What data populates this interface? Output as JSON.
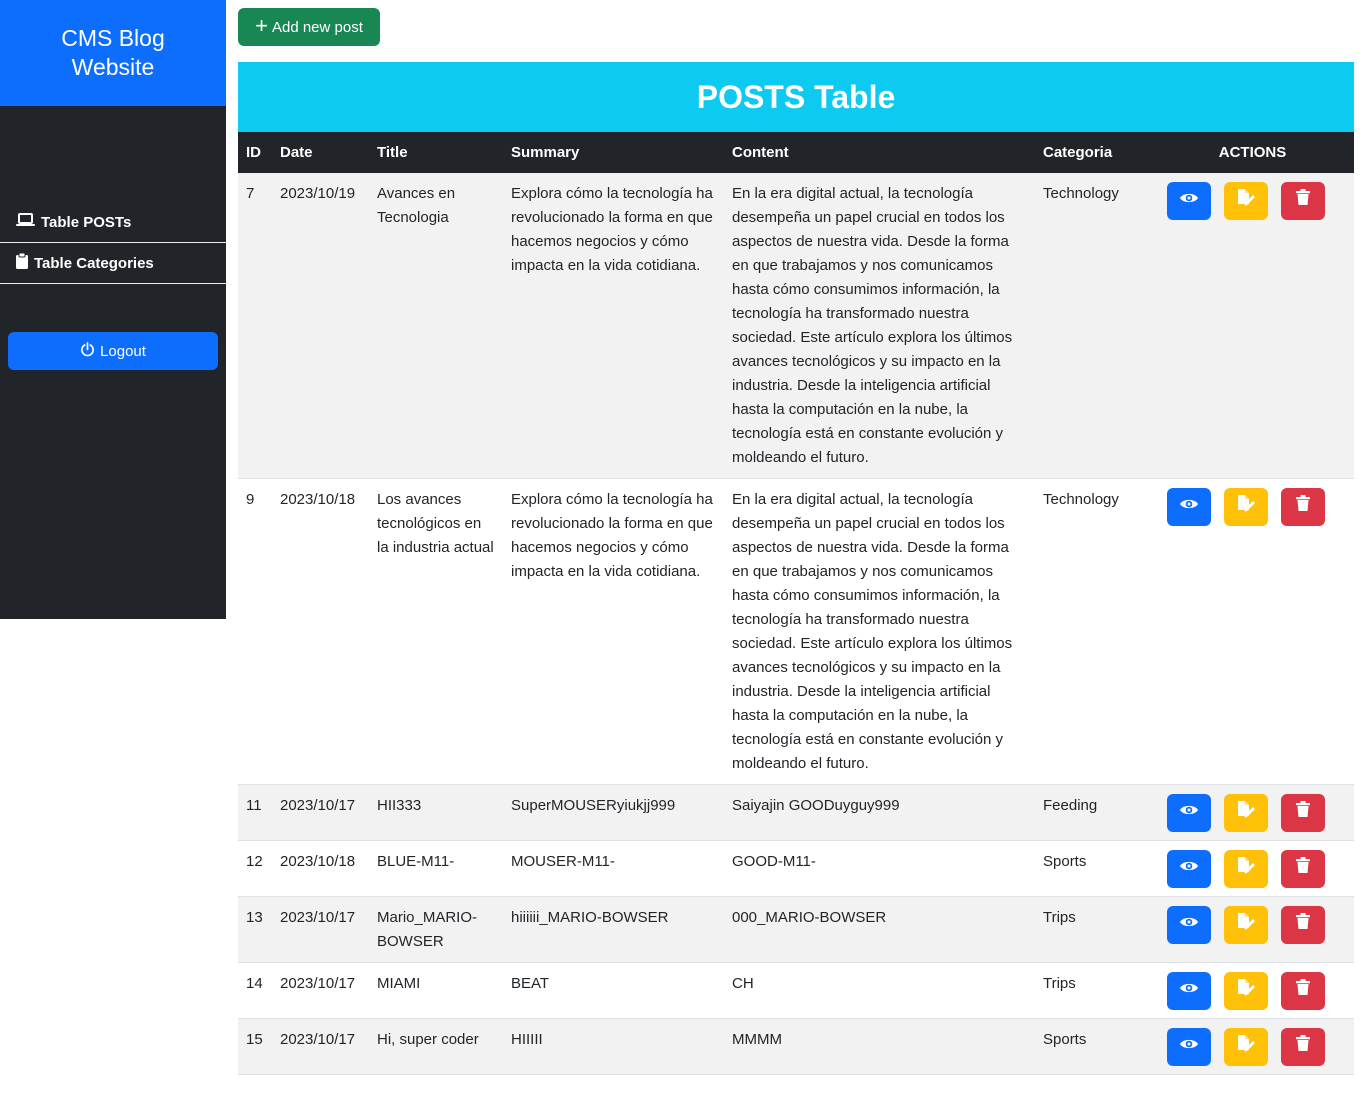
{
  "sidebar": {
    "brand": "CMS Blog Website",
    "items": [
      {
        "label": "Table POSTs",
        "icon": "laptop-icon"
      },
      {
        "label": "Table Categories",
        "icon": "clipboard-icon"
      }
    ],
    "logout_label": "Logout"
  },
  "toolbar": {
    "add_label": "Add new post"
  },
  "table": {
    "title": "POSTS Table",
    "columns": [
      "ID",
      "Date",
      "Title",
      "Summary",
      "Content",
      "Categoria",
      "ACTIONS"
    ],
    "rows": [
      {
        "id": "7",
        "date": "2023/10/19",
        "title": "Avances en Tecnologia",
        "summary": "Explora cómo la tecnología ha revolucionado la forma en que hacemos negocios y cómo impacta en la vida cotidiana.",
        "content": "En la era digital actual, la tecnología desempeña un papel crucial en todos los aspectos de nuestra vida. Desde la forma en que trabajamos y nos comunicamos hasta cómo consumimos información, la tecnología ha transformado nuestra sociedad. Este artículo explora los últimos avances tecnológicos y su impacto en la industria. Desde la inteligencia artificial hasta la computación en la nube, la tecnología está en constante evolución y moldeando el futuro.",
        "category": "Technology"
      },
      {
        "id": "9",
        "date": "2023/10/18",
        "title": "Los avances tecnológicos en la industria actual",
        "summary": "Explora cómo la tecnología ha revolucionado la forma en que hacemos negocios y cómo impacta en la vida cotidiana.",
        "content": "En la era digital actual, la tecnología desempeña un papel crucial en todos los aspectos de nuestra vida. Desde la forma en que trabajamos y nos comunicamos hasta cómo consumimos información, la tecnología ha transformado nuestra sociedad. Este artículo explora los últimos avances tecnológicos y su impacto en la industria. Desde la inteligencia artificial hasta la computación en la nube, la tecnología está en constante evolución y moldeando el futuro.",
        "category": "Technology"
      },
      {
        "id": "11",
        "date": "2023/10/17",
        "title": "HII333",
        "summary": "SuperMOUSERyiukjj999",
        "content": "Saiyajin GOODuyguy999",
        "category": "Feeding"
      },
      {
        "id": "12",
        "date": "2023/10/18",
        "title": "BLUE-M11-",
        "summary": "MOUSER-M11-",
        "content": "GOOD-M11-",
        "category": "Sports"
      },
      {
        "id": "13",
        "date": "2023/10/17",
        "title": "Mario_MARIO-BOWSER",
        "summary": "hiiiiii_MARIO-BOWSER",
        "content": "000_MARIO-BOWSER",
        "category": "Trips"
      },
      {
        "id": "14",
        "date": "2023/10/17",
        "title": "MIAMI",
        "summary": "BEAT",
        "content": "CH",
        "category": "Trips"
      },
      {
        "id": "15",
        "date": "2023/10/17",
        "title": "Hi, super coder",
        "summary": "HIIIII",
        "content": "MMMM",
        "category": "Sports"
      }
    ]
  },
  "colors": {
    "primary": "#0d6efd",
    "success": "#198754",
    "info": "#0dcaf0",
    "warning": "#ffc107",
    "danger": "#dc3545",
    "dark": "#212529"
  }
}
